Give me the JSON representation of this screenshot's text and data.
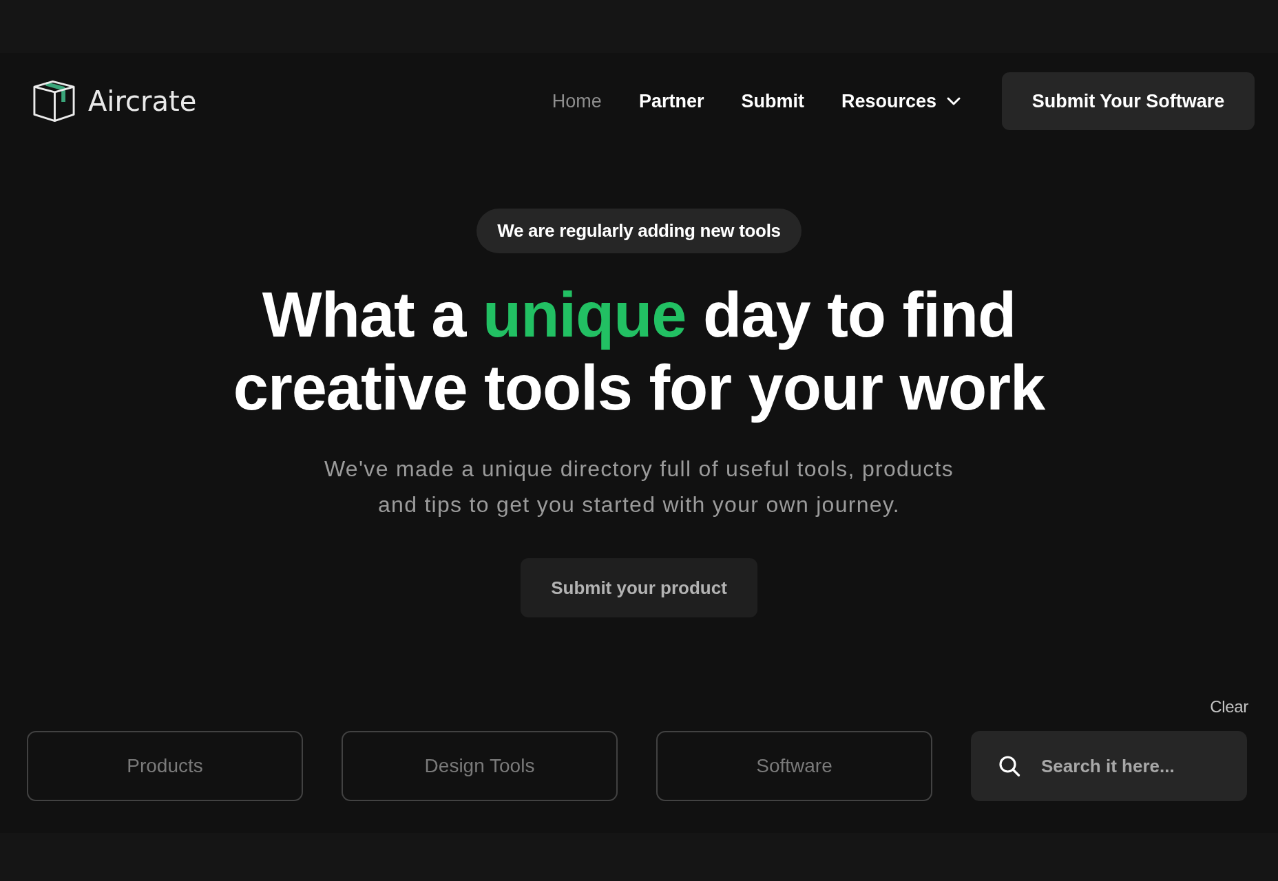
{
  "header": {
    "logo": {
      "name": "Aircrate"
    },
    "nav": [
      {
        "label": "Home",
        "selected": true,
        "kind": "link"
      },
      {
        "label": "Partner",
        "selected": false,
        "kind": "link"
      },
      {
        "label": "Submit",
        "selected": false,
        "kind": "link"
      },
      {
        "label": "Resources",
        "selected": false,
        "kind": "dropdown"
      }
    ],
    "cta": "Submit Your Software"
  },
  "hero": {
    "badge": "We are regularly adding new tools",
    "title": [
      {
        "text": "What a ",
        "accent": false
      },
      {
        "text": "unique",
        "accent": true
      },
      {
        "text": " day to find creative tools for your work",
        "accent": false
      }
    ],
    "subtitle": "We've made a unique directory full of useful tools, products and tips to get you started with your own journey.",
    "cta": "Submit your product"
  },
  "filters": {
    "clear": "Clear",
    "categories": [
      {
        "label": "Products"
      },
      {
        "label": "Design Tools"
      },
      {
        "label": "Software"
      }
    ],
    "search": {
      "placeholder": "Search it here..."
    }
  }
}
